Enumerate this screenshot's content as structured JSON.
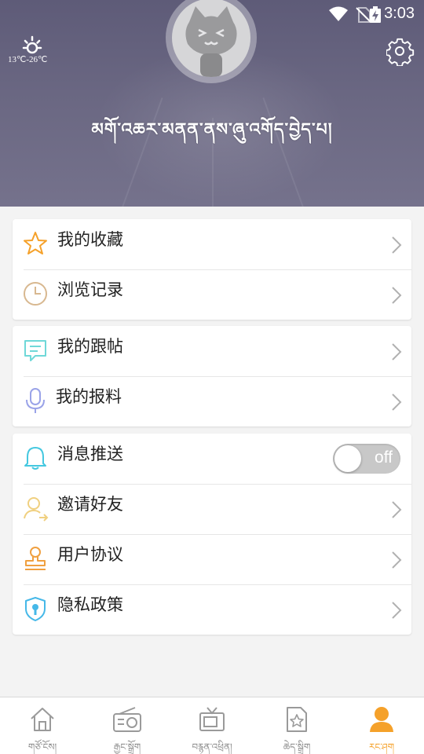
{
  "status_bar": {
    "time": "3:03"
  },
  "header": {
    "weather": {
      "temps": "13℃-26℃",
      "icon": "sun-icon"
    },
    "tagline": "མགོ་འཆར་མནན་ནས་ཞུ་འགོད་བྱེད་པ།",
    "settings_icon": "gear-icon",
    "avatar_icon": "cat-avatar"
  },
  "groups": [
    {
      "items": [
        {
          "label": "我的收藏",
          "icon": "star-icon"
        },
        {
          "label": "浏览记录",
          "icon": "clock-icon"
        }
      ]
    },
    {
      "items": [
        {
          "label": "我的跟帖",
          "icon": "comment-icon"
        },
        {
          "label": "我的报料",
          "icon": "microphone-icon"
        }
      ]
    },
    {
      "items": [
        {
          "label": "消息推送",
          "icon": "bell-icon",
          "toggle": "off"
        },
        {
          "label": "邀请好友",
          "icon": "invite-user-icon"
        },
        {
          "label": "用户协议",
          "icon": "stamp-icon"
        },
        {
          "label": "隐私政策",
          "icon": "privacy-shield-icon"
        }
      ]
    }
  ],
  "tabs": [
    {
      "label": "གཙོ་ངོས།",
      "icon": "home-icon"
    },
    {
      "label": "རྒྱང་སྒྲོག",
      "icon": "radio-icon"
    },
    {
      "label": "བརྙན་འཕྲིན།",
      "icon": "tv-icon"
    },
    {
      "label": "ཆེད་སྒྲིག",
      "icon": "feature-doc-icon"
    },
    {
      "label": "རང་ཤག",
      "icon": "user-icon",
      "active": true
    }
  ],
  "colors": {
    "header_bg": "#65627e",
    "accent": "#f5a12a",
    "star": "#f5a12a",
    "clock": "#d8b890",
    "comment": "#6fd8d8",
    "microphone": "#9aa3e8",
    "bell": "#45c8e0",
    "invite": "#f0d080",
    "stamp": "#f0a040",
    "privacy": "#45b8e8",
    "toggle_off": "#c8c8c8"
  }
}
